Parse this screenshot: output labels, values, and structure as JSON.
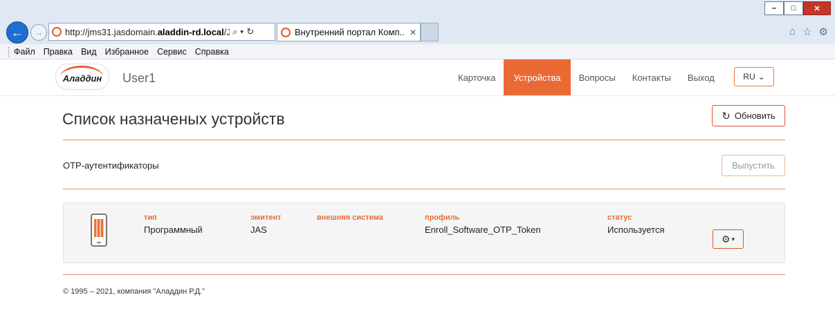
{
  "browser": {
    "url": "http://jms31.jasdomain.aladdin-rd.local/JM",
    "url_prefix": "http://jms31.jasdomain.",
    "url_host": "aladdin-rd.local",
    "url_suffix": "/JM",
    "tab_title": "Внутренний портал Комп...",
    "menu": [
      "Файл",
      "Правка",
      "Вид",
      "Избранное",
      "Сервис",
      "Справка"
    ]
  },
  "header": {
    "logo_text": "Аладдин",
    "username": "User1",
    "nav": [
      "Карточка",
      "Устройства",
      "Вопросы",
      "Контакты",
      "Выход"
    ],
    "active_nav": "Устройства",
    "lang": "RU"
  },
  "main": {
    "title": "Список назначеных устройств",
    "refresh_label": "Обновить",
    "section_title": "OTP-аутентификаторы",
    "issue_label": "Выпустить",
    "device": {
      "type_label": "тип",
      "type_value": "Программный",
      "issuer_label": "эмитент",
      "issuer_value": "JAS",
      "external_label": "внешняя система",
      "external_value": "",
      "profile_label": "профиль",
      "profile_value": "Enroll_Software_OTP_Token",
      "status_label": "статус",
      "status_value": "Используется"
    }
  },
  "footer": {
    "copyright": "© 1995 – 2021, компания \"Аладдин Р.Д.\""
  }
}
